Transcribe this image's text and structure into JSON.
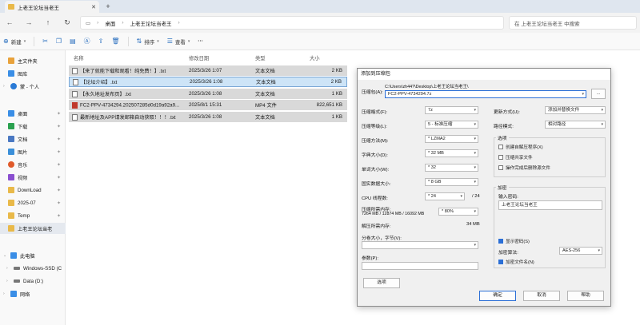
{
  "window": {
    "tab_title": "上老王论坛当老王",
    "breadcrumb": [
      "桌面",
      "上老王论坛当老王"
    ],
    "search_placeholder": "在 上老王论坛当老王 中搜索"
  },
  "toolbar": {
    "new_label": "新建",
    "sort_label": "排序",
    "view_label": "查看",
    "more_label": "···"
  },
  "sidebar": {
    "items": [
      {
        "label": "主文件夹",
        "icon": "home-icon",
        "color": "#e9a23b"
      },
      {
        "label": "图库",
        "icon": "gallery-icon",
        "color": "#3a8ee6"
      },
      {
        "label": "蒙 - 个人",
        "icon": "cloud-icon",
        "color": "#2a7ad6"
      },
      {
        "label": "桌面",
        "icon": "desktop-icon",
        "color": "#3a8ee6"
      },
      {
        "label": "下载",
        "icon": "download-icon",
        "color": "#2aa14f"
      },
      {
        "label": "文档",
        "icon": "document-icon",
        "color": "#4a78c2"
      },
      {
        "label": "图片",
        "icon": "picture-icon",
        "color": "#3b8fd9"
      },
      {
        "label": "音乐",
        "icon": "music-icon",
        "color": "#e05a2b"
      },
      {
        "label": "视频",
        "icon": "video-icon",
        "color": "#8a4fd0"
      },
      {
        "label": "DownLoad",
        "icon": "folder-icon",
        "color": "#e9b949"
      },
      {
        "label": "2025-07",
        "icon": "folder-icon",
        "color": "#e9b949"
      },
      {
        "label": "Temp",
        "icon": "folder-icon",
        "color": "#e9b949"
      },
      {
        "label": "上老王论坛当老",
        "icon": "folder-icon",
        "color": "#e9b949"
      },
      {
        "label": "此电脑",
        "icon": "computer-icon",
        "color": "#3a8ee6"
      },
      {
        "label": "Windows-SSD (C",
        "icon": "drive-icon",
        "color": "#777777"
      },
      {
        "label": "Data (D:)",
        "icon": "drive-icon",
        "color": "#777777"
      },
      {
        "label": "网络",
        "icon": "network-icon",
        "color": "#3a8ee6"
      }
    ]
  },
  "filelist": {
    "headers": {
      "name": "名称",
      "date": "修改日期",
      "type": "类型",
      "size": "大小"
    },
    "rows": [
      {
        "name": "【来了就能下载和观看！纯免费！】.txt",
        "date": "2025/3/26 1:07",
        "type": "文本文档",
        "size": "2 KB"
      },
      {
        "name": "【论坛介绍】.txt",
        "date": "2025/3/26 1:08",
        "type": "文本文档",
        "size": "2 KB"
      },
      {
        "name": "【永久地址发布页】.txt",
        "date": "2025/3/26 1:08",
        "type": "文本文档",
        "size": "1 KB"
      },
      {
        "name": "FC2-PPV-4734294.202507285d0d19a92a9...",
        "date": "2025/8/1 15:31",
        "type": "MP4 文件",
        "size": "822,651 KB"
      },
      {
        "name": "最新地址及APP请发邮箱自动获取！！！.txt",
        "date": "2025/3/26 1:08",
        "type": "文本文档",
        "size": "1 KB"
      }
    ]
  },
  "dialog": {
    "title": "添加到压缩包",
    "archive_name_label": "压缩包(A):",
    "archive_path": "C:\\Users\\zh44?\\Desktop\\上老王论坛当老王\\",
    "archive_name": "FC2-PPV-4734294.7z",
    "browse_label": "...",
    "format_label": "压缩格式(F):",
    "format_value": "7z",
    "level_label": "压缩等级(L):",
    "level_value": "5 - 标准压缩",
    "method_label": "压缩方法(M):",
    "method_value": "* LZMA2",
    "dict_label": "字典大小(D):",
    "dict_value": "* 32 MB",
    "word_label": "单词大小(W):",
    "word_value": "* 32",
    "solid_label": "固实数据大小:",
    "solid_value": "* 8 GB",
    "threads_label": "CPU 线程数:",
    "threads_value": "* 24",
    "threads_total": "/ 24",
    "mem_label": "压缩所需内存:",
    "mem_detail": "7264 MB / 12874 MB / 16092 MB",
    "mem_value": "* 80%",
    "decomp_label": "解压所需内存:",
    "decomp_value": "34 MB",
    "split_label": "分卷大小，字节(V):",
    "params_label": "参数(P):",
    "options_button": "选项",
    "update_label": "更新方式(U):",
    "update_value": "添加并替换文件",
    "path_mode_label": "路径模式:",
    "path_mode_value": "相对路径",
    "options_group": "选项",
    "opt_sfx": "创建自解压程序(X)",
    "opt_shared": "压缩共享文件",
    "opt_delete": "操作完成后删除源文件",
    "encrypt_group": "加密",
    "password_label": "输入密码:",
    "password_value": "上老王论坛当老王",
    "show_password": "显示密码(S)",
    "encrypt_method_label": "加密算法:",
    "encrypt_method_value": "AES-256",
    "encrypt_names": "加密文件名(N)",
    "ok": "确定",
    "cancel": "取消",
    "help": "帮助"
  }
}
